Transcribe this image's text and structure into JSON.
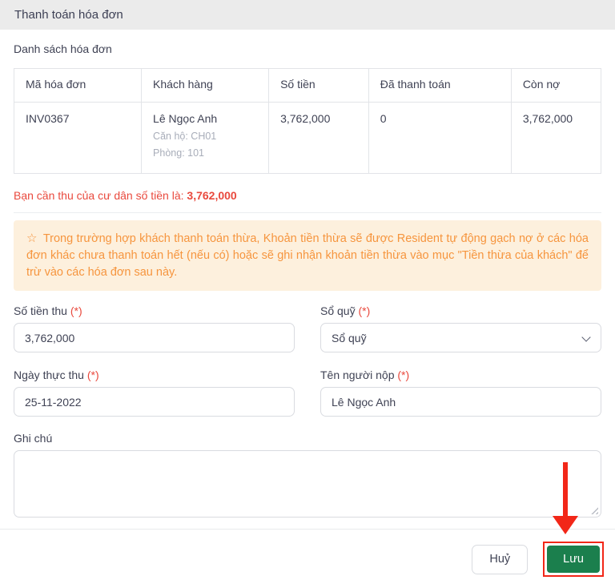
{
  "dialog": {
    "title": "Thanh toán hóa đơn"
  },
  "invoice_list": {
    "label": "Danh sách hóa đơn",
    "table": {
      "columns": [
        "Mã hóa đơn",
        "Khách hàng",
        "Số tiền",
        "Đã thanh toán",
        "Còn nợ"
      ],
      "rows": [
        {
          "invoice_code": "INV0367",
          "customer_name": "Lê Ngọc Anh",
          "customer_apartment": "Căn hộ: CH01",
          "customer_room": "Phòng: 101",
          "amount": "3,762,000",
          "paid": "0",
          "debt": "3,762,000"
        }
      ]
    }
  },
  "summary": {
    "text": "Bạn cần thu của cư dân số tiền là:",
    "amount": "3,762,000"
  },
  "notice": {
    "icon": "star-outline",
    "star_glyph": "☆",
    "text": "Trong trường hợp khách thanh toán thừa, Khoản tiền thừa sẽ được Resident tự động gạch nợ ở các hóa đơn khác chưa thanh toán hết (nếu có) hoặc sẽ ghi nhận khoản tiền thừa vào mục \"Tiền thừa của khách\" để trừ vào các hóa đơn sau này."
  },
  "form": {
    "required_mark": "(*)",
    "amount_field": {
      "label": "Số tiền thu",
      "value": "3,762,000"
    },
    "fund_field": {
      "label": "Sổ quỹ",
      "value": "Sổ quỹ"
    },
    "date_field": {
      "label": "Ngày thực thu",
      "value": "25-11-2022"
    },
    "payer_field": {
      "label": "Tên người nộp",
      "value": "Lê Ngọc Anh"
    },
    "note_field": {
      "label": "Ghi chú",
      "value": ""
    }
  },
  "footer": {
    "cancel_label": "Huỷ",
    "save_label": "Lưu"
  },
  "colors": {
    "header_bg": "#ebebeb",
    "alert_red": "#e9493d",
    "notice_bg": "#fdf0dd",
    "notice_text": "#f6953e",
    "save_green": "#1b7f4d",
    "annotation_red": "#f22718"
  }
}
